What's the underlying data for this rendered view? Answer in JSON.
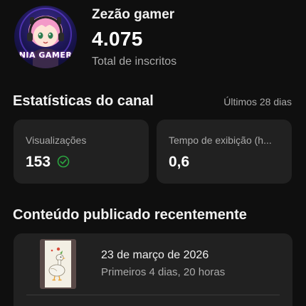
{
  "channel": {
    "name": "Zezão gamer",
    "subscriber_count": "4.075",
    "subscriber_label": "Total de inscritos",
    "avatar_text": "NIA GAMER"
  },
  "stats": {
    "title": "Estatísticas do canal",
    "period": "Últimos 28 dias",
    "cards": [
      {
        "label": "Visualizações",
        "value": "153",
        "icon": "check-circle-icon"
      },
      {
        "label": "Tempo de exibição (h...",
        "value": "0,6"
      }
    ]
  },
  "recent": {
    "title": "Conteúdo publicado recentemente",
    "items": [
      {
        "date": "23 de março de 2026",
        "period": "Primeiros 4 dias, 20 horas"
      }
    ]
  },
  "colors": {
    "background": "#0f0f0f",
    "card": "#212121",
    "accent_green": "#2ba640",
    "secondary_text": "#aaaaaa"
  }
}
